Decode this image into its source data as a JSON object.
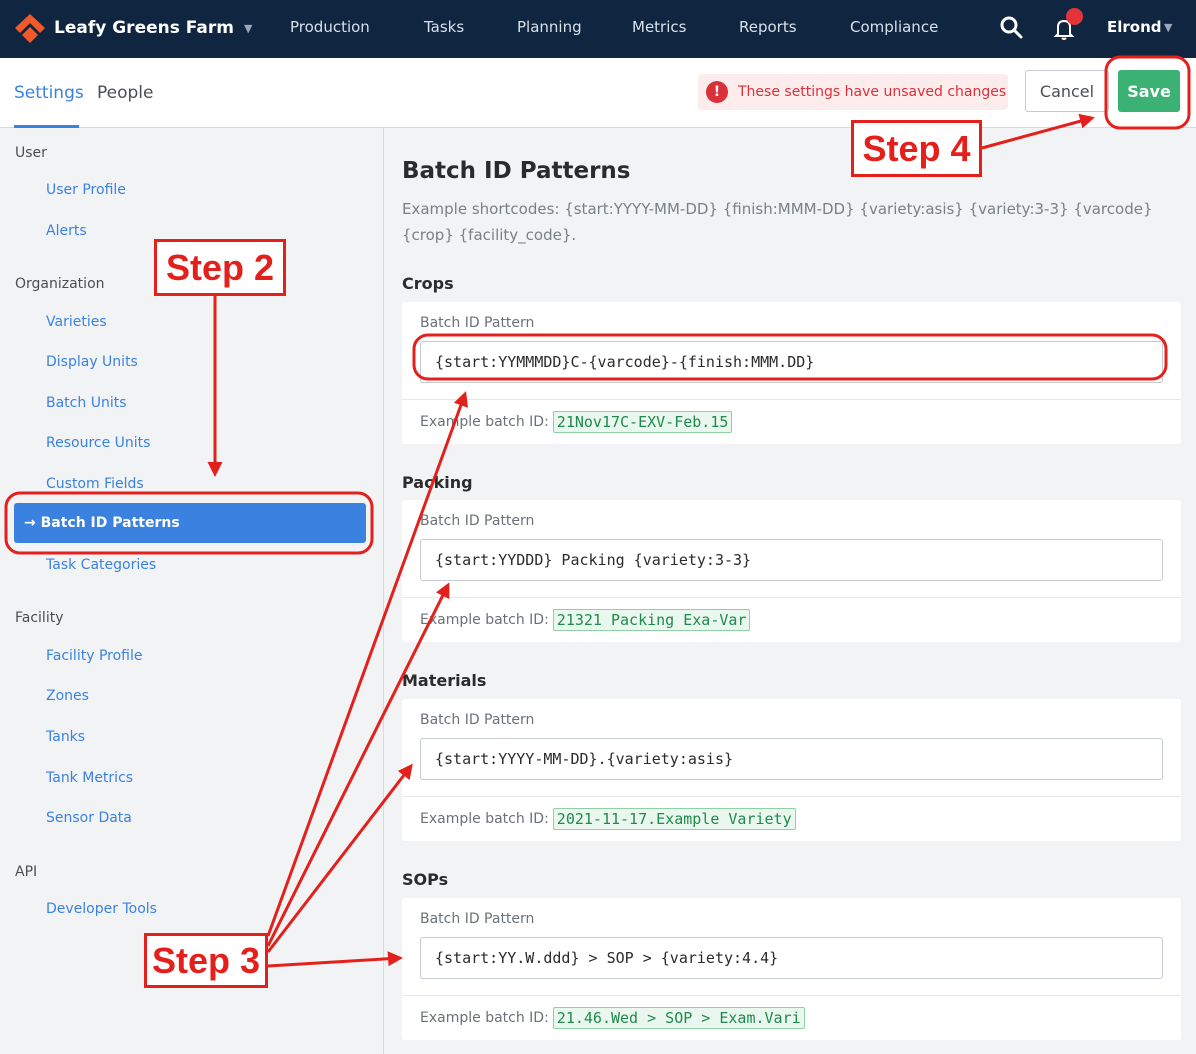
{
  "brand": {
    "name": "Leafy Greens Farm"
  },
  "nav": [
    "Production",
    "Tasks",
    "Planning",
    "Metrics",
    "Reports",
    "Compliance"
  ],
  "user": {
    "name": "Elrond"
  },
  "tabs": {
    "settings": "Settings",
    "people": "People"
  },
  "unsaved": {
    "message": "These settings have unsaved changes"
  },
  "actions": {
    "cancel": "Cancel",
    "save": "Save"
  },
  "sidebar": {
    "groups": {
      "user": "User",
      "organization": "Organization",
      "facility": "Facility",
      "api": "API"
    },
    "items": {
      "user_profile": "User Profile",
      "alerts": "Alerts",
      "varieties": "Varieties",
      "display_units": "Display Units",
      "batch_units": "Batch Units",
      "resource_units": "Resource Units",
      "custom_fields": "Custom Fields",
      "batch_id_patterns": "→ Batch ID Patterns",
      "task_categories": "Task Categories",
      "facility_profile": "Facility Profile",
      "zones": "Zones",
      "tanks": "Tanks",
      "tank_metrics": "Tank Metrics",
      "sensor_data": "Sensor Data",
      "developer_tools": "Developer Tools"
    }
  },
  "main": {
    "title": "Batch ID Patterns",
    "shortcodes": "Example shortcodes: {start:YYYY-MM-DD} {finish:MMM-DD} {variety:asis} {variety:3-3} {varcode} {crop} {facility_code}.",
    "field_label": "Batch ID Pattern",
    "example_label": "Example batch ID:",
    "sections": {
      "crops": {
        "title": "Crops",
        "pattern": "{start:YYMMMDD}C-{varcode}-{finish:MMM.DD}",
        "example": "21Nov17C-EXV-Feb.15"
      },
      "packing": {
        "title": "Packing",
        "pattern": "{start:YYDDD} Packing {variety:3-3}",
        "example": "21321 Packing Exa-Var"
      },
      "materials": {
        "title": "Materials",
        "pattern": "{start:YYYY-MM-DD}.{variety:asis}",
        "example": "2021-11-17.Example Variety"
      },
      "sops": {
        "title": "SOPs",
        "pattern": "{start:YY.W.ddd} > SOP > {variety:4.4}",
        "example": "21.46.Wed > SOP > Exam.Vari"
      }
    }
  },
  "annotations": {
    "step2": "Step 2",
    "step3": "Step 3",
    "step4": "Step 4",
    "color": "#e3201b"
  }
}
